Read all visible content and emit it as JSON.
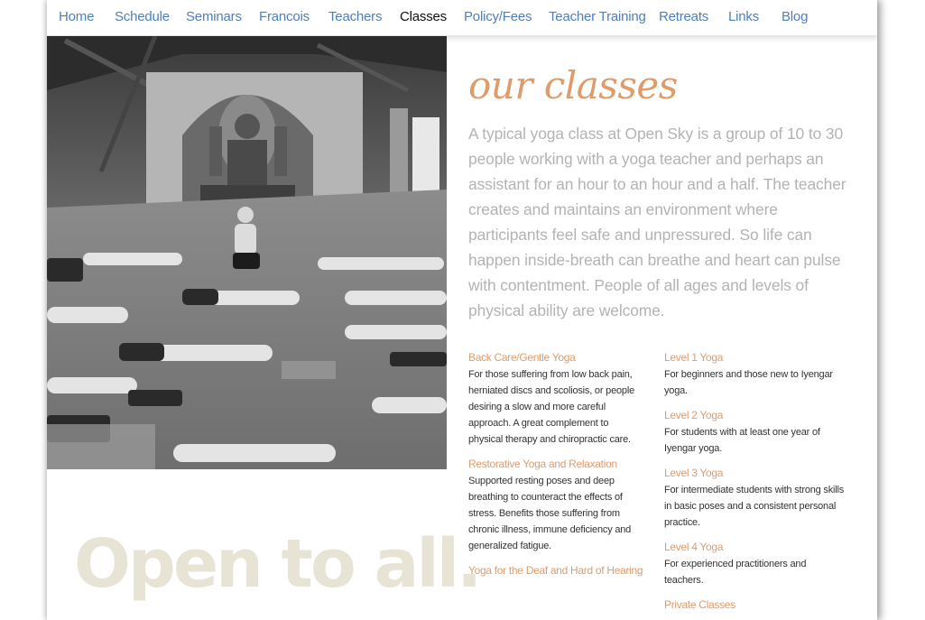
{
  "nav": {
    "items": [
      {
        "label": "Home",
        "active": false
      },
      {
        "label": "Schedule",
        "active": false
      },
      {
        "label": "Seminars",
        "active": false
      },
      {
        "label": "Francois",
        "active": false
      },
      {
        "label": "Teachers",
        "active": false
      },
      {
        "label": "Classes",
        "active": true
      },
      {
        "label": "Policy/Fees",
        "active": false
      },
      {
        "label": "Teacher Training",
        "active": false
      },
      {
        "label": "Retreats",
        "active": false
      },
      {
        "label": "Links",
        "active": false
      },
      {
        "label": "Blog",
        "active": false
      }
    ]
  },
  "colors": {
    "nav_link": "#4f7fb8",
    "nav_active": "#111111",
    "accent": "#df9c6a",
    "intro_text": "#b3b3b3",
    "tagline": "#e7e4d6"
  },
  "main": {
    "heading": "our classes",
    "intro": "A typical yoga class at Open Sky is a group of 10 to 30 people working with a yoga teacher and perhaps an assistant for an hour to an hour and a half. The teacher creates and maintains an environment where participants feel safe and unpressured. So life can happen inside-breath can breathe and heart can pulse with contentment. People of all ages and levels of physical ability are welcome."
  },
  "tagline": "Open to all.",
  "classes_left": [
    {
      "title": "Back Care/Gentle Yoga",
      "desc": "For those suffering from low back pain, herniated discs and scoliosis, or people desiring a slow and more careful approach. A great complement to physical therapy and chiropractic care."
    },
    {
      "title": "Restorative Yoga and Relaxation",
      "desc": "Supported resting poses and deep breathing to counteract the effects of stress. Benefits those suffering from chronic illness, immune deficiency and generalized fatigue."
    },
    {
      "title": "Yoga for the Deaf and Hard of Hearing",
      "desc": ""
    }
  ],
  "classes_right": [
    {
      "title": "Level 1 Yoga",
      "desc": "For beginners and those new to Iyengar yoga."
    },
    {
      "title": "Level 2 Yoga",
      "desc": "For students with at least one year of Iyengar yoga."
    },
    {
      "title": "Level 3 Yoga",
      "desc": "For intermediate students with strong skills in basic poses and a consistent personal practice."
    },
    {
      "title": "Level 4 Yoga",
      "desc": "For experienced practitioners and teachers."
    },
    {
      "title": "Private Classes",
      "desc": ""
    }
  ]
}
